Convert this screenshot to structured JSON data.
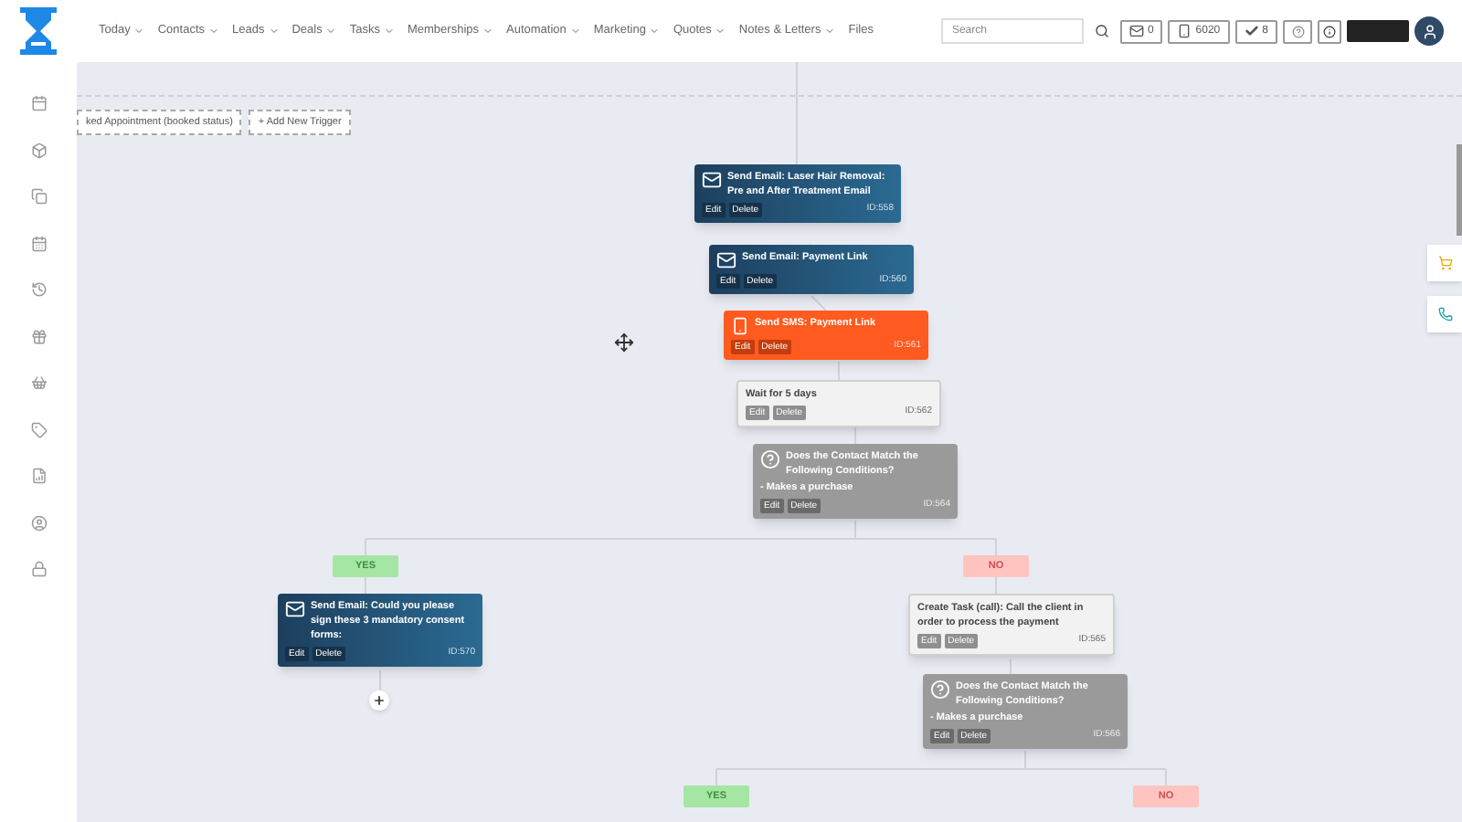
{
  "nav": {
    "items": [
      {
        "label": "Today"
      },
      {
        "label": "Contacts"
      },
      {
        "label": "Leads"
      },
      {
        "label": "Deals"
      },
      {
        "label": "Tasks"
      },
      {
        "label": "Memberships"
      },
      {
        "label": "Automation"
      },
      {
        "label": "Marketing"
      },
      {
        "label": "Quotes"
      },
      {
        "label": "Notes & Letters"
      },
      {
        "label": "Files",
        "dropdown": false
      }
    ],
    "search": {
      "placeholder": "Search"
    },
    "counters": [
      {
        "kind": "mail",
        "value": "0"
      },
      {
        "kind": "phone",
        "value": "6020"
      },
      {
        "kind": "check",
        "value": "8"
      }
    ]
  },
  "triggers": [
    {
      "label": "ked Appointment (booked status)"
    },
    {
      "label": "+ Add New Trigger"
    }
  ],
  "nodes": [
    {
      "kind": "email",
      "title": "Send Email: Laser Hair Removal: Pre and After Treatment Email",
      "id": "ID:558",
      "edit": "Edit",
      "delete": "Delete"
    },
    {
      "kind": "email",
      "title": "Send Email: Payment Link",
      "id": "ID:560",
      "edit": "Edit",
      "delete": "Delete"
    },
    {
      "kind": "sms",
      "title": "Send SMS: Payment Link",
      "id": "ID:561",
      "edit": "Edit",
      "delete": "Delete"
    },
    {
      "kind": "wait",
      "title": "Wait for 5 days",
      "id": "ID:562",
      "edit": "Edit",
      "delete": "Delete"
    },
    {
      "kind": "condition",
      "title": "Does the Contact Match the Following Conditions?",
      "detail": "- Makes a purchase",
      "id": "ID:564",
      "edit": "Edit",
      "delete": "Delete"
    },
    {
      "kind": "email",
      "title": "Send Email: Could you please sign these 3 mandatory consent forms:",
      "id": "ID:570",
      "edit": "Edit",
      "delete": "Delete"
    },
    {
      "kind": "task",
      "title": "Create Task (call): Call the client in order to process the payment",
      "id": "ID:565",
      "edit": "Edit",
      "delete": "Delete"
    },
    {
      "kind": "condition",
      "title": "Does the Contact Match the Following Conditions?",
      "detail": "- Makes a purchase",
      "id": "ID:566",
      "edit": "Edit",
      "delete": "Delete"
    }
  ],
  "branches": [
    {
      "kind": "yes",
      "label": "YES"
    },
    {
      "kind": "no",
      "label": "NO"
    },
    {
      "kind": "yes",
      "label": "YES"
    },
    {
      "kind": "no",
      "label": "NO"
    }
  ]
}
